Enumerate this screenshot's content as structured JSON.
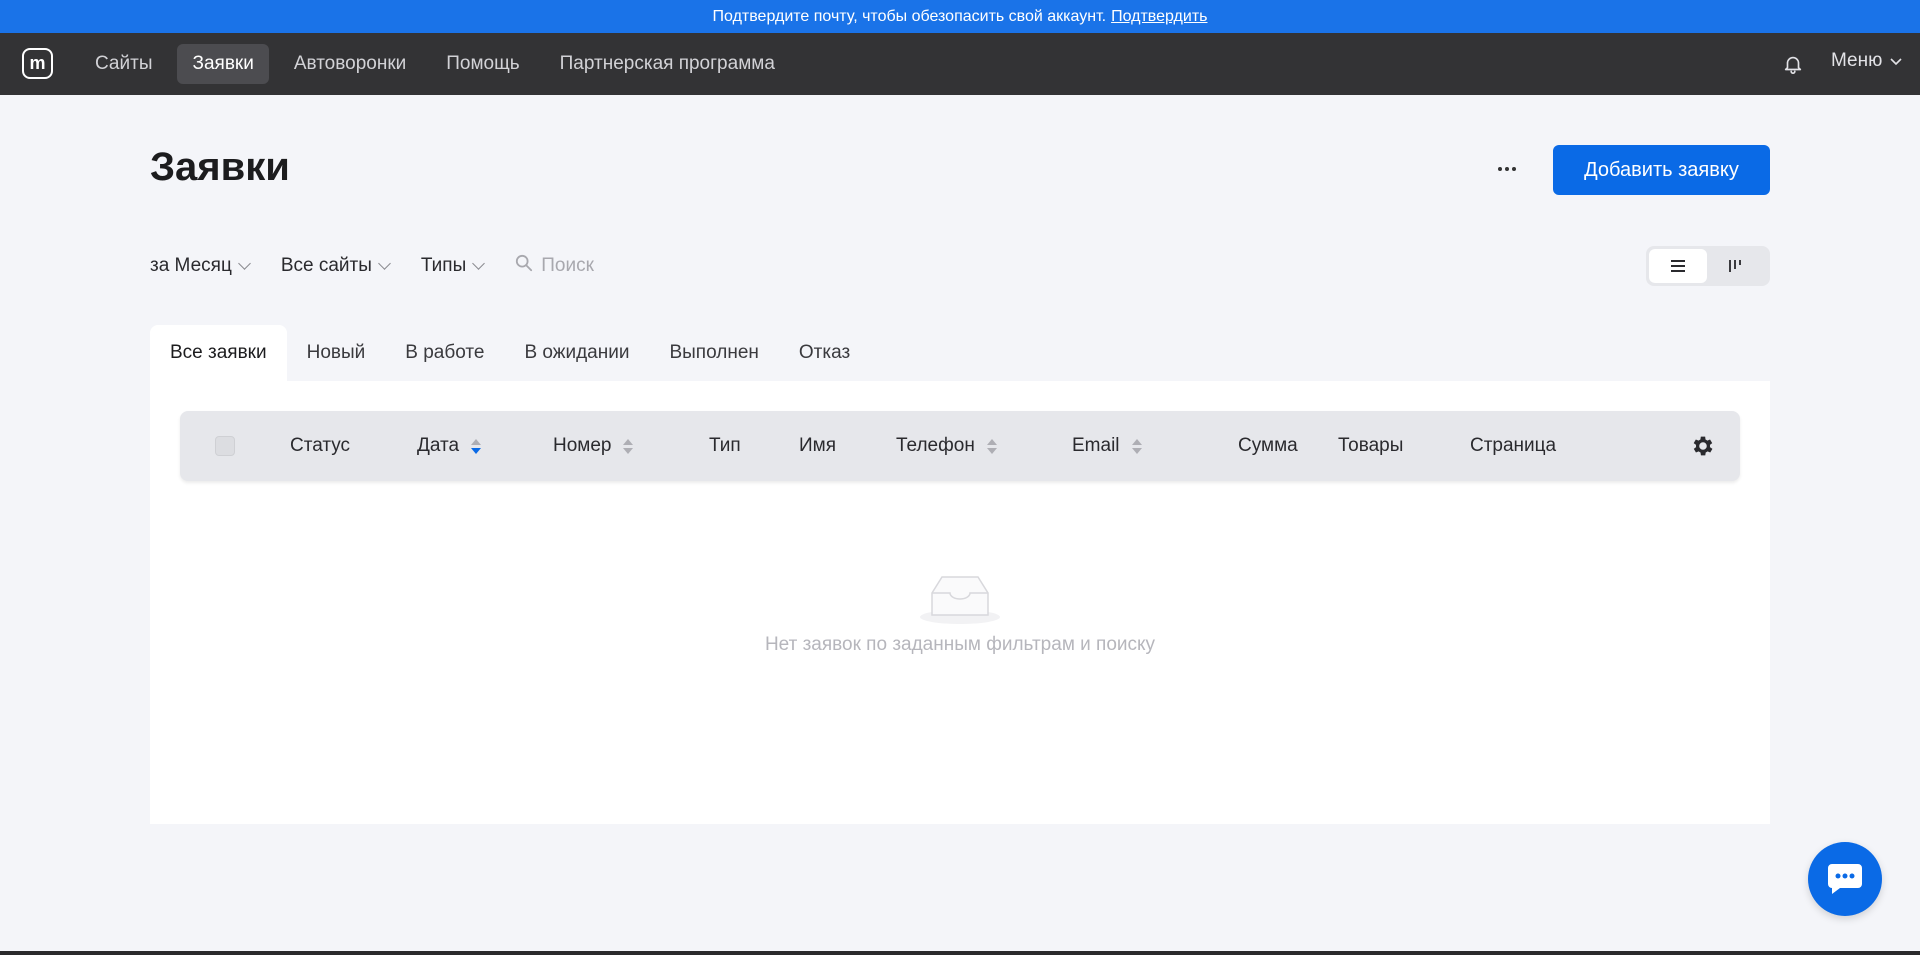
{
  "banner": {
    "text": "Подтвердите почту, чтобы обезопасить свой аккаунт.",
    "link": "Подтвердить"
  },
  "nav": {
    "logo": "m",
    "items": [
      "Сайты",
      "Заявки",
      "Автоворонки",
      "Помощь",
      "Партнерская программа"
    ],
    "active_index": 1,
    "menu_label": "Меню"
  },
  "page": {
    "title": "Заявки",
    "more_label": "···",
    "add_button": "Добавить заявку"
  },
  "filters": {
    "period": "за Месяц",
    "sites": "Все сайты",
    "types": "Типы",
    "search_placeholder": "Поиск"
  },
  "tabs": [
    "Все заявки",
    "Новый",
    "В работе",
    "В ожидании",
    "Выполнен",
    "Отказ"
  ],
  "table": {
    "columns": [
      "Статус",
      "Дата",
      "Номер",
      "Тип",
      "Имя",
      "Телефон",
      "Email",
      "Сумма",
      "Товары",
      "Страница"
    ]
  },
  "empty_state": {
    "text": "Нет заявок по заданным фильтрам и поиску"
  },
  "colors": {
    "accent": "#0a6ae6",
    "banner": "#1a73e8",
    "nav_bg": "#333335"
  }
}
